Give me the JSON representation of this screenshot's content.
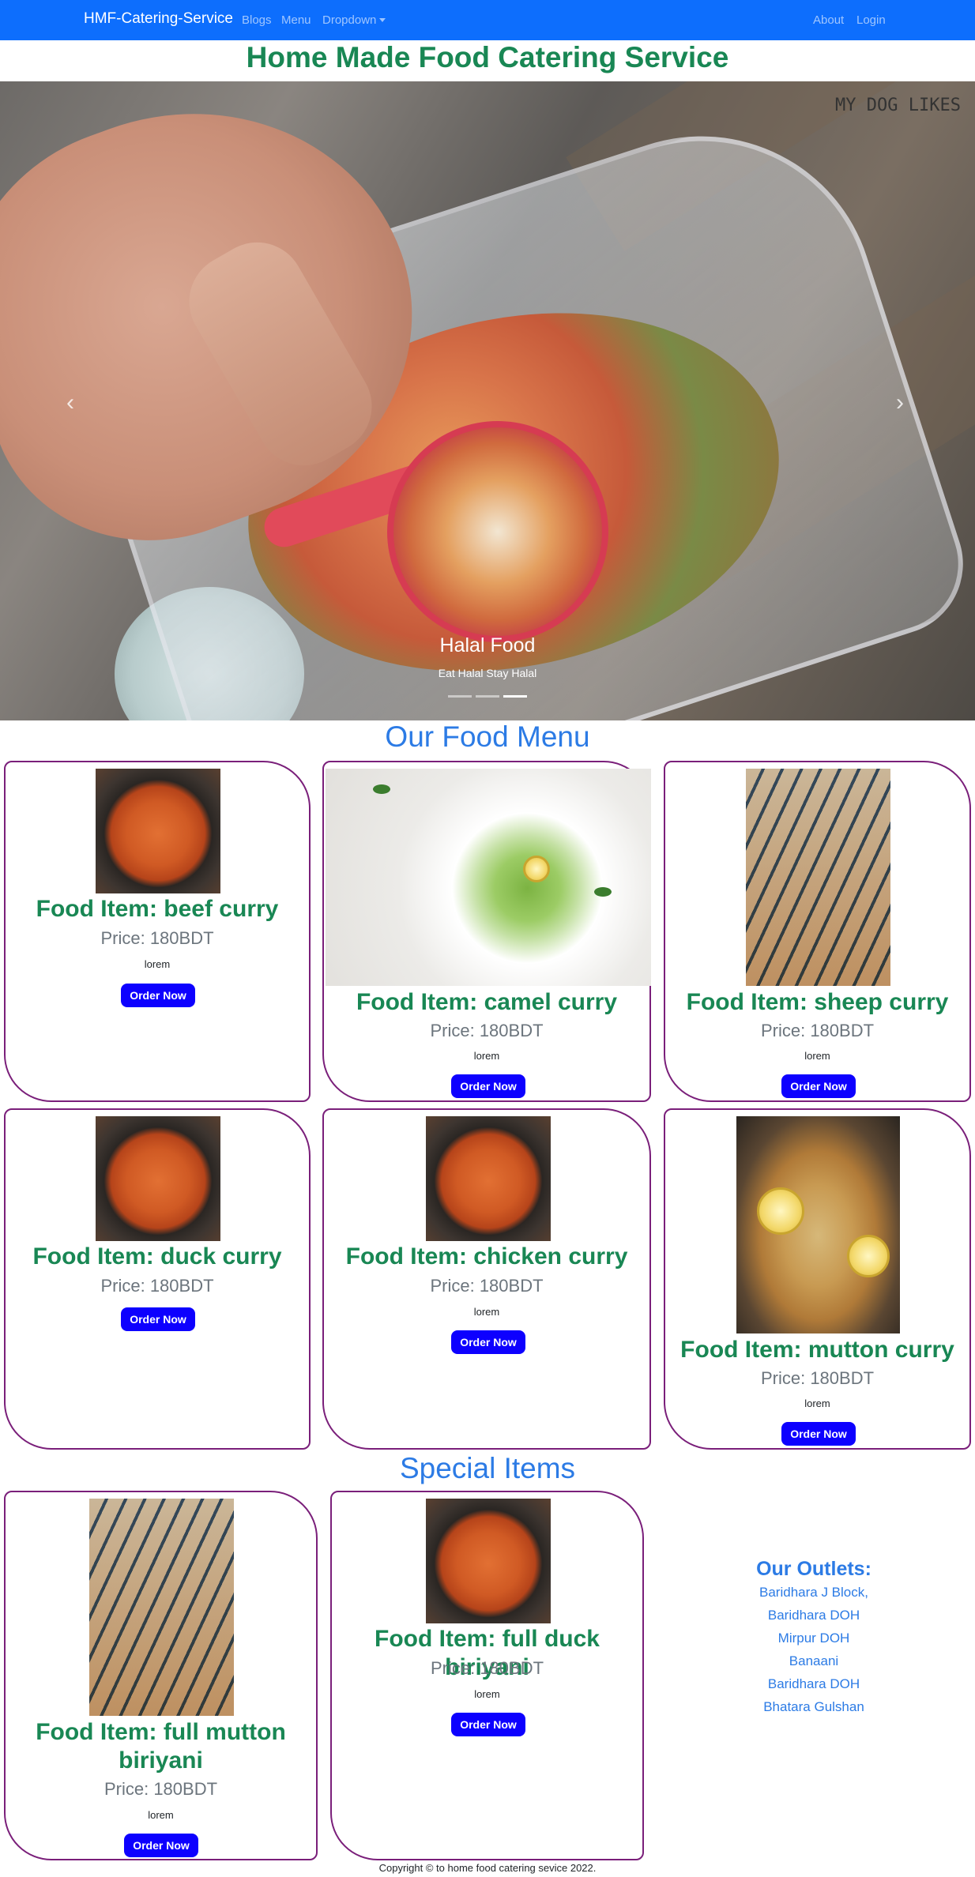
{
  "nav": {
    "brand": "HMF-Catering-Service",
    "links": [
      "Blogs",
      "Menu"
    ],
    "dropdown": "Dropdown",
    "right": [
      "About",
      "Login"
    ]
  },
  "site_title": "Home Made Food Catering Service",
  "hero": {
    "logo": "MY DOG LIKES",
    "caption_title": "Halal Food",
    "caption_sub": "Eat Halal Stay Halal",
    "prev_icon": "‹",
    "next_icon": "›",
    "active_slide": 3
  },
  "menu_title": "Our Food Menu",
  "menu_items": [
    {
      "name": "Food Item: beef curry",
      "price": "Price: 180BDT",
      "desc": "lorem",
      "button": "Order Now"
    },
    {
      "name": "Food Item: camel curry",
      "price": "Price: 180BDT",
      "desc": "lorem",
      "button": "Order Now"
    },
    {
      "name": "Food Item: sheep curry",
      "price": "Price: 180BDT",
      "desc": "lorem",
      "button": "Order Now"
    },
    {
      "name": "Food Item: duck curry",
      "price": "Price: 180BDT",
      "desc": "",
      "button": "Order Now"
    },
    {
      "name": "Food Item: chicken curry",
      "price": "Price: 180BDT",
      "desc": "lorem",
      "button": "Order Now"
    },
    {
      "name": "Food Item: mutton curry",
      "price": "Price: 180BDT",
      "desc": "lorem",
      "button": "Order Now"
    }
  ],
  "special_title": "Special Items",
  "special_items": [
    {
      "name": "Food Item: full mutton biriyani",
      "price": "Price: 180BDT",
      "desc": "lorem",
      "button": "Order Now"
    },
    {
      "name": "Food Item: full duck biriyani",
      "price": "Price: 180BDT",
      "desc": "lorem",
      "button": "Order Now"
    }
  ],
  "outlets": {
    "title": "Our Outlets:",
    "list": [
      "Baridhara J Block,",
      "Baridhara DOH",
      "Mirpur DOH",
      "Banaani",
      "Baridhara DOH",
      "Bhatara Gulshan"
    ]
  },
  "footer": "Copyright © to home food catering sevice 2022.",
  "colors": {
    "nav": "#0d6efd",
    "title_green": "#198754",
    "section_blue": "#2c7be5",
    "button": "#0d00ff",
    "card_border": "#7a1f7a"
  }
}
